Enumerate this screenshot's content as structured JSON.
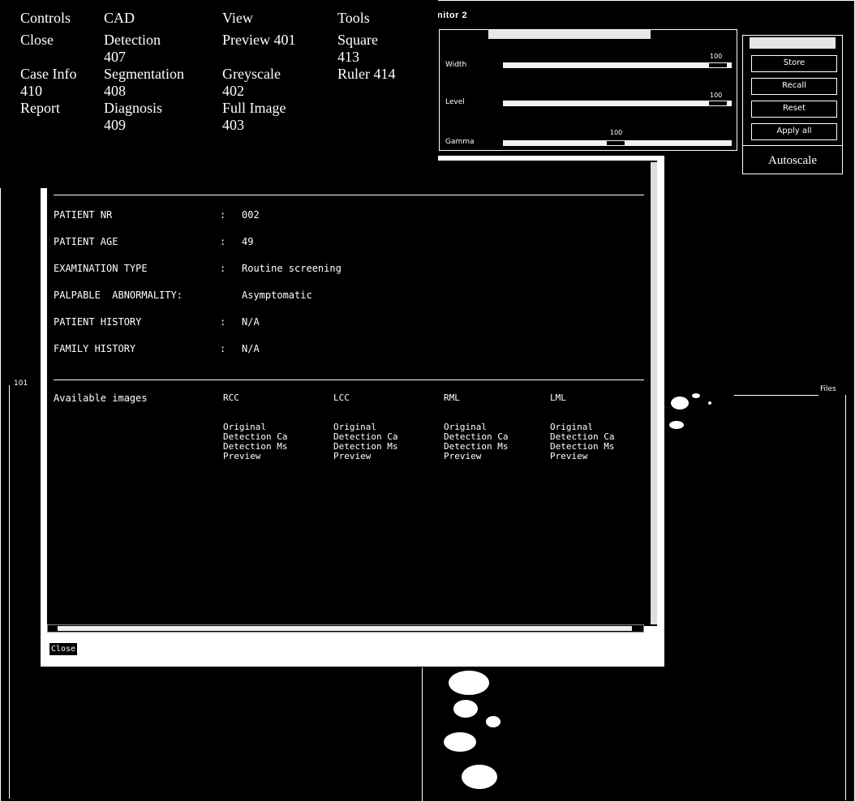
{
  "window": {
    "title": "nitor 2"
  },
  "menu": {
    "columns": [
      {
        "heading": "Controls",
        "items": [
          "Close",
          "Case Info 410",
          "Report"
        ]
      },
      {
        "heading": "CAD",
        "items": [
          "Detection 407",
          "Segmentation 408",
          "Diagnosis 409"
        ]
      },
      {
        "heading": "View",
        "items": [
          "Preview 401",
          "Greyscale 402",
          "Full Image 403"
        ]
      },
      {
        "heading": "Tools",
        "items": [
          "Square 413",
          "Ruler 414"
        ]
      }
    ]
  },
  "window_level": {
    "sliders": [
      {
        "label": "Width",
        "value": "100"
      },
      {
        "label": "Level",
        "value": "100"
      },
      {
        "label": "Gamma",
        "value": "100"
      }
    ]
  },
  "side_buttons": {
    "buttons": [
      "Store",
      "Recall",
      "Reset",
      "Apply all"
    ],
    "autoscale": "Autoscale"
  },
  "case_info": {
    "fields": [
      {
        "label": "PATIENT NR",
        "colon": ":",
        "value": "002"
      },
      {
        "label": "PATIENT AGE",
        "colon": ":",
        "value": "49"
      },
      {
        "label": "EXAMINATION TYPE",
        "colon": ":",
        "value": "Routine screening"
      },
      {
        "label": "PALPABLE  ABNORMALITY:",
        "colon": "",
        "value": "Asymptomatic"
      },
      {
        "label": "PATIENT HISTORY",
        "colon": ":",
        "value": "N/A"
      },
      {
        "label": "FAMILY HISTORY",
        "colon": ":",
        "value": "N/A"
      }
    ],
    "available_images_label": "Available images",
    "views": [
      {
        "name": "RCC",
        "items": [
          "Original",
          "Detection Ca",
          "Detection Ms",
          "Preview"
        ]
      },
      {
        "name": "LCC",
        "items": [
          "Original",
          "Detection Ca",
          "Detection Ms",
          "Preview"
        ]
      },
      {
        "name": "RML",
        "items": [
          "Original",
          "Detection Ca",
          "Detection Ms",
          "Preview"
        ]
      },
      {
        "name": "LML",
        "items": [
          "Original",
          "Detection Ca",
          "Detection Ms",
          "Preview"
        ]
      }
    ],
    "close_label": "Close"
  },
  "labels": {
    "files": "Files",
    "left_tag": "101"
  }
}
